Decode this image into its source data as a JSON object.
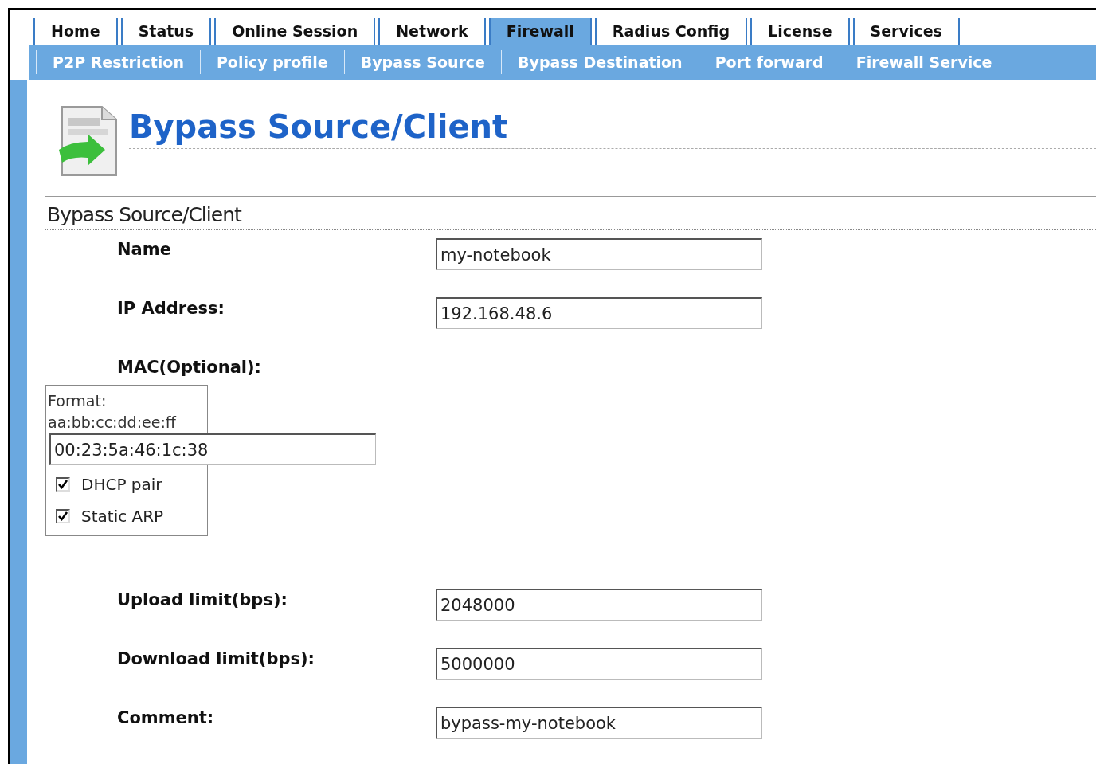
{
  "tabs": [
    {
      "label": "Home",
      "selected": false
    },
    {
      "label": "Status",
      "selected": false
    },
    {
      "label": "Online Session",
      "selected": false
    },
    {
      "label": "Network",
      "selected": false
    },
    {
      "label": "Firewall",
      "selected": true
    },
    {
      "label": "Radius Config",
      "selected": false
    },
    {
      "label": "License",
      "selected": false
    },
    {
      "label": "Services",
      "selected": false
    }
  ],
  "subtabs": [
    "P2P Restriction",
    "Policy profile",
    "Bypass Source",
    "Bypass Destination",
    "Port forward",
    "Firewall Service"
  ],
  "page_title": "Bypass Source/Client",
  "section_title": "Bypass Source/Client",
  "fields": [
    {
      "kind": "text",
      "label": "Name",
      "value": "my-notebook"
    },
    {
      "kind": "text",
      "label": "IP Address:",
      "value": "192.168.48.6"
    },
    {
      "kind": "mac",
      "label": "MAC(Optional):",
      "hint": "Format: aa:bb:cc:dd:ee:ff",
      "value": "00:23:5a:46:1c:38",
      "options": [
        {
          "label": "DHCP pair",
          "checked": true
        },
        {
          "label": "Static ARP",
          "checked": true
        }
      ]
    },
    {
      "kind": "text",
      "label": "Upload limit(bps):",
      "value": "2048000"
    },
    {
      "kind": "text",
      "label": "Download limit(bps):",
      "value": "5000000"
    },
    {
      "kind": "text",
      "label": "Comment:",
      "value": "bypass-my-notebook"
    }
  ]
}
